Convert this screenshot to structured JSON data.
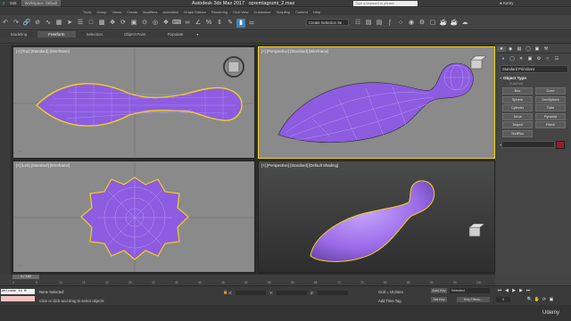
{
  "titlebar": {
    "workspace": "Workspace: Default",
    "menus": [
      "Edit",
      "Tools",
      "Group",
      "Views",
      "Create",
      "Modifiers",
      "Animation",
      "Graph Editors",
      "Rendering",
      "Civil View",
      "Customize",
      "Scripting",
      "Content",
      "Help"
    ],
    "app_title": "Autodesk 3ds Max 2017",
    "file_name": "opremiagrumi_2.max",
    "search_placeholder": "Type a keyword or phrase",
    "user": "Kemy"
  },
  "toolbar": {
    "selection_set": "Create Selection Se"
  },
  "ribbon": {
    "tabs": [
      "Modeling",
      "Freeform",
      "Selection",
      "Object Paint",
      "Populate"
    ],
    "active": "Freeform"
  },
  "viewports": [
    {
      "label": "[+] [Top] [Standard] [Wireframe]"
    },
    {
      "label": "[+] [Perspective] [Standard] [Wireframe]"
    },
    {
      "label": "[+] [Left] [Standard] [Wireframe]"
    },
    {
      "label": "[+] [Perspective] [Standard] [Default Shading]"
    }
  ],
  "command_panel": {
    "dropdown": "Standard Primitives",
    "object_type_title": "Object Type",
    "autogrid": "AutoGrid",
    "primitives": [
      "Box",
      "Cone",
      "Sphere",
      "GeoSphere",
      "Cylinder",
      "Tube",
      "Torus",
      "Pyramid",
      "Teapot",
      "Plane",
      "TextPlus"
    ],
    "name_color_title": "Name and Color",
    "object_color": "#a0182e"
  },
  "timeline": {
    "slider": "0 / 100",
    "ticks": [
      "0",
      "5",
      "10",
      "15",
      "20",
      "25",
      "30",
      "35",
      "40",
      "45",
      "50",
      "55",
      "60",
      "65",
      "70",
      "75",
      "80",
      "85",
      "90",
      "95",
      "100"
    ]
  },
  "status": {
    "maxscript": "Welcome to M",
    "none_selected": "None Selected",
    "prompt": "Click or click-and-drag to select objects",
    "x_label": "X:",
    "y_label": "Y:",
    "z_label": "Z:",
    "grid": "Grid = 10,0mm",
    "add_time_tag": "Add Time Tag",
    "auto_key": "Auto Key",
    "set_key": "Set Key",
    "selected": "Selected",
    "key_filters": "Key Filters...",
    "frame": "0",
    "watermark": "Udemy"
  },
  "colors": {
    "object_purple": "#9b6ae8",
    "selection_yellow": "#f2d21b",
    "active_blue": "#3d84b9"
  }
}
